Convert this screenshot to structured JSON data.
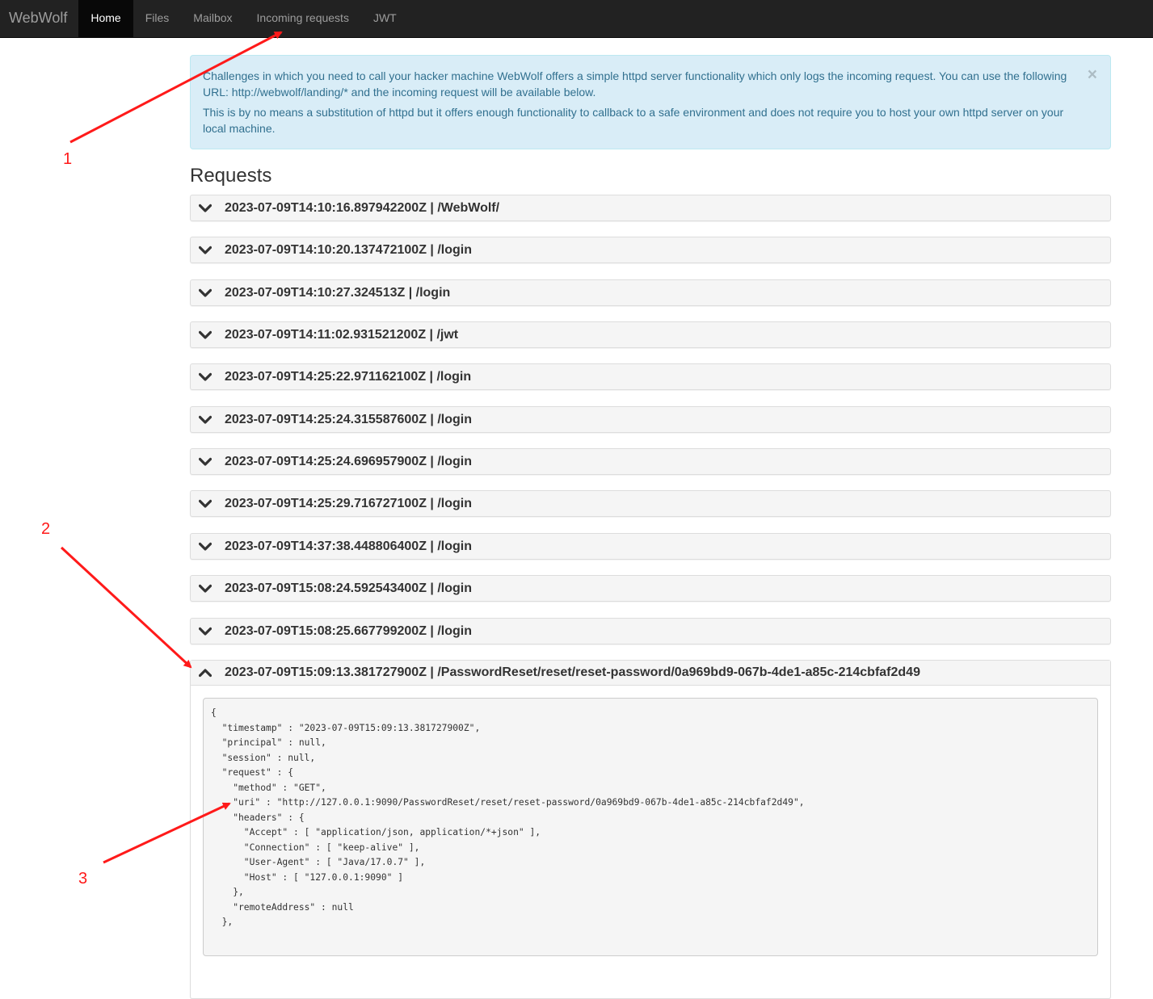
{
  "navbar": {
    "brand": "WebWolf",
    "items": [
      {
        "label": "Home",
        "active": true
      },
      {
        "label": "Files",
        "active": false
      },
      {
        "label": "Mailbox",
        "active": false
      },
      {
        "label": "Incoming requests",
        "active": false
      },
      {
        "label": "JWT",
        "active": false
      }
    ]
  },
  "alert": {
    "paragraph1": "Challenges in which you need to call your hacker machine WebWolf offers a simple httpd server functionality which only logs the incoming request. You can use the following URL: http://webwolf/landing/* and the incoming request will be available below.",
    "paragraph2": "This is by no means a substitution of httpd but it offers enough functionality to callback to a safe environment and does not require you to host your own httpd server on your local machine.",
    "close": "×"
  },
  "requests": {
    "title": "Requests",
    "items": [
      "2023-07-09T14:10:16.897942200Z | /WebWolf/",
      "2023-07-09T14:10:20.137472100Z | /login",
      "2023-07-09T14:10:27.324513Z | /login",
      "2023-07-09T14:11:02.931521200Z | /jwt",
      "2023-07-09T14:25:22.971162100Z | /login",
      "2023-07-09T14:25:24.315587600Z | /login",
      "2023-07-09T14:25:24.696957900Z | /login",
      "2023-07-09T14:25:29.716727100Z | /login",
      "2023-07-09T14:37:38.448806400Z | /login",
      "2023-07-09T15:08:24.592543400Z | /login",
      "2023-07-09T15:08:25.667799200Z | /login"
    ],
    "expanded": {
      "title": "2023-07-09T15:09:13.381727900Z | /PasswordReset/reset/reset-password/0a969bd9-067b-4de1-a85c-214cbfaf2d49",
      "json": "{\n  \"timestamp\" : \"2023-07-09T15:09:13.381727900Z\",\n  \"principal\" : null,\n  \"session\" : null,\n  \"request\" : {\n    \"method\" : \"GET\",\n    \"uri\" : \"http://127.0.0.1:9090/PasswordReset/reset/reset-password/0a969bd9-067b-4de1-a85c-214cbfaf2d49\",\n    \"headers\" : {\n      \"Accept\" : [ \"application/json, application/*+json\" ],\n      \"Connection\" : [ \"keep-alive\" ],\n      \"User-Agent\" : [ \"Java/17.0.7\" ],\n      \"Host\" : [ \"127.0.0.1:9090\" ]\n    },\n    \"remoteAddress\" : null\n  },"
    }
  },
  "annotations": {
    "labels": [
      "1",
      "2",
      "3"
    ],
    "color": "#ff1a1a"
  }
}
